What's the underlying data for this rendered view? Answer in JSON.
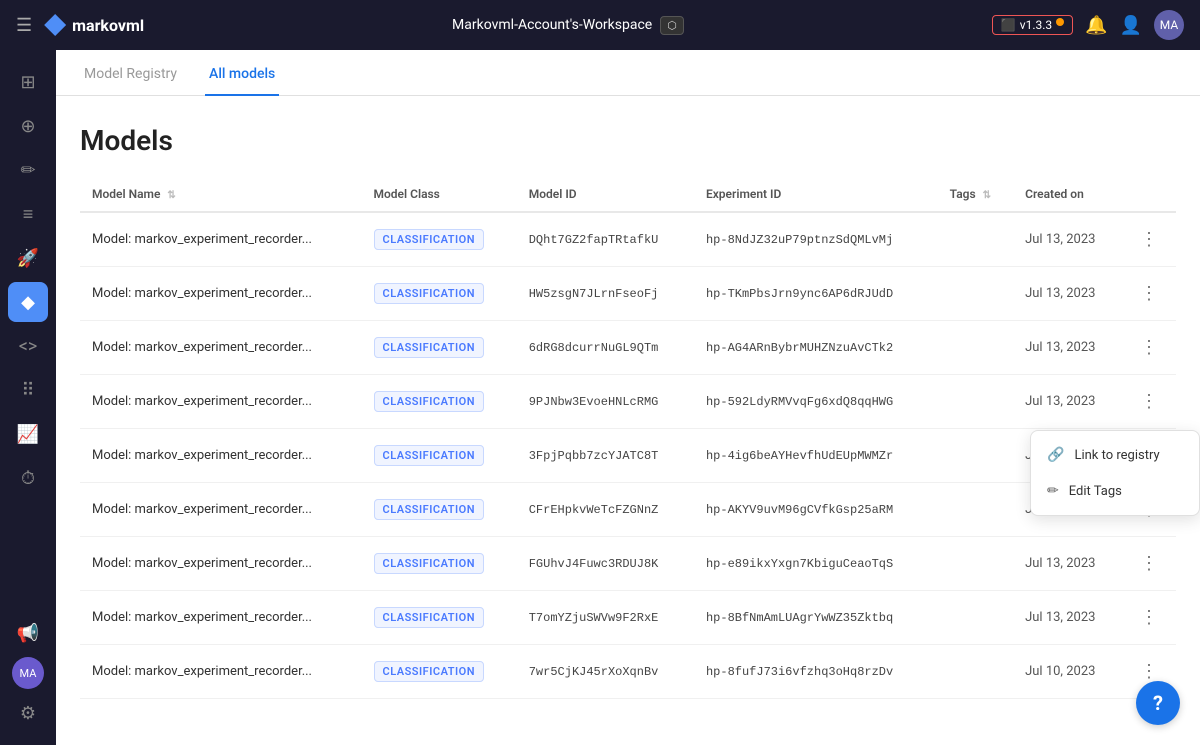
{
  "topbar": {
    "menu_label": "☰",
    "logo_text": "markovml",
    "workspace": "Markovml-Account's-Workspace",
    "export_label": "⬡",
    "version": "v1.3.3",
    "bell": "🔔",
    "user": "👤"
  },
  "sidebar": {
    "items": [
      {
        "id": "dashboard",
        "icon": "⊞",
        "active": false
      },
      {
        "id": "add",
        "icon": "⊕",
        "active": false
      },
      {
        "id": "analytics",
        "icon": "✏",
        "active": false
      },
      {
        "id": "list",
        "icon": "≡",
        "active": false
      },
      {
        "id": "rocket",
        "icon": "🚀",
        "active": false
      },
      {
        "id": "diamond",
        "icon": "◆",
        "active": true
      },
      {
        "id": "code",
        "icon": "<>",
        "active": false
      },
      {
        "id": "grid",
        "icon": "⠿",
        "active": false
      },
      {
        "id": "chart",
        "icon": "📈",
        "active": false
      },
      {
        "id": "history",
        "icon": "⏱",
        "active": false
      },
      {
        "id": "megaphone",
        "icon": "📢",
        "active": false
      }
    ],
    "avatar_initials": "MA",
    "settings_icon": "⚙"
  },
  "tabs": [
    {
      "label": "Model Registry",
      "active": false
    },
    {
      "label": "All models",
      "active": true
    }
  ],
  "page": {
    "title": "Models"
  },
  "table": {
    "columns": [
      {
        "label": "Model Name",
        "sortable": true
      },
      {
        "label": "Model Class",
        "sortable": false
      },
      {
        "label": "Model ID",
        "sortable": false
      },
      {
        "label": "Experiment ID",
        "sortable": false
      },
      {
        "label": "Tags",
        "sortable": true
      },
      {
        "label": "Created on",
        "sortable": false
      }
    ],
    "rows": [
      {
        "model_name": "Model: markov_experiment_recorder...",
        "model_class": "CLASSIFICATION",
        "model_id": "DQht7GZ2fapTRtafkU",
        "experiment_id": "hp-8NdJZ32uP79ptnzSdQMLvMj",
        "tags": "",
        "created_on": "Jul 13, 2023"
      },
      {
        "model_name": "Model: markov_experiment_recorder...",
        "model_class": "CLASSIFICATION",
        "model_id": "HW5zsgN7JLrnFseoFj",
        "experiment_id": "hp-TKmPbsJrn9ync6AP6dRJUdD",
        "tags": "",
        "created_on": "Jul 13, 2023"
      },
      {
        "model_name": "Model: markov_experiment_recorder...",
        "model_class": "CLASSIFICATION",
        "model_id": "6dRG8dcurrNuGL9QTm",
        "experiment_id": "hp-AG4ARnBybrMUHZNzuAvCTk2",
        "tags": "",
        "created_on": "Jul 13, 2023"
      },
      {
        "model_name": "Model: markov_experiment_recorder...",
        "model_class": "CLASSIFICATION",
        "model_id": "9PJNbw3EvoeHNLcRMG",
        "experiment_id": "hp-592LdyRMVvqFg6xdQ8qqHWG",
        "tags": "",
        "created_on": "Jul 13, 2023"
      },
      {
        "model_name": "Model: markov_experiment_recorder...",
        "model_class": "CLASSIFICATION",
        "model_id": "3FpjPqbb7zcYJATC8T",
        "experiment_id": "hp-4ig6beAYHevfhUdEUpMWMZr",
        "tags": "",
        "created_on": "Jul 13, 2023"
      },
      {
        "model_name": "Model: markov_experiment_recorder...",
        "model_class": "CLASSIFICATION",
        "model_id": "CFrEHpkvWeTcFZGNnZ",
        "experiment_id": "hp-AKYV9uvM96gCVfkGsp25aRM",
        "tags": "",
        "created_on": "Jul 13, 2023"
      },
      {
        "model_name": "Model: markov_experiment_recorder...",
        "model_class": "CLASSIFICATION",
        "model_id": "FGUhvJ4Fuwc3RDUJ8K",
        "experiment_id": "hp-e89ikxYxgn7KbiguCeaoTqS",
        "tags": "",
        "created_on": "Jul 13, 2023"
      },
      {
        "model_name": "Model: markov_experiment_recorder...",
        "model_class": "CLASSIFICATION",
        "model_id": "T7omYZjuSWVw9F2RxE",
        "experiment_id": "hp-8BfNmAmLUAgrYwWZ35Zktbq",
        "tags": "",
        "created_on": "Jul 13, 2023"
      },
      {
        "model_name": "Model: markov_experiment_recorder...",
        "model_class": "CLASSIFICATION",
        "model_id": "7wr5CjKJ45rXoXqnBv",
        "experiment_id": "hp-8fufJ73i6vfzhq3oHq8rzDv",
        "tags": "",
        "created_on": "Jul 10, 2023"
      }
    ]
  },
  "context_menu": {
    "items": [
      {
        "id": "link-to-registry",
        "icon": "🔗",
        "label": "Link to registry"
      },
      {
        "id": "edit-tags",
        "icon": "✏",
        "label": "Edit Tags"
      }
    ]
  },
  "help_btn_label": "?"
}
